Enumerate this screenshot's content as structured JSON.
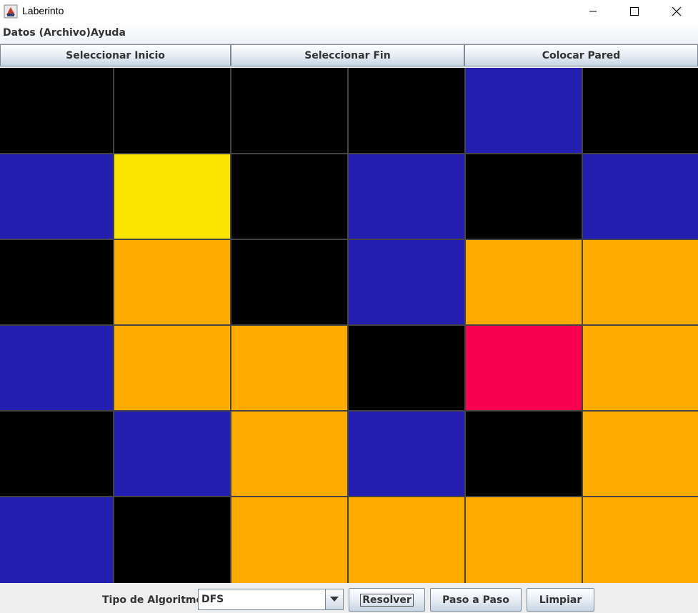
{
  "window": {
    "title": "Laberinto",
    "icon": "java-cup-icon",
    "controls": [
      "minimize-icon",
      "maximize-icon",
      "close-icon"
    ]
  },
  "menu": [
    {
      "label": "Datos (Archivo)"
    },
    {
      "label": "Ayuda"
    }
  ],
  "toolbar": {
    "select_start": "Seleccionar Inicio",
    "select_end": "Seleccionar Fin",
    "place_wall": "Colocar Pared"
  },
  "maze": {
    "rows": 6,
    "cols": 6,
    "colors": {
      "wall": "#000000",
      "open": "#241fb0",
      "start": "#f9e400",
      "visited": "#ffab00",
      "end": "#f6004f",
      "gridline": "#444444"
    },
    "cells": [
      [
        "wall",
        "wall",
        "wall",
        "wall",
        "open",
        "wall"
      ],
      [
        "open",
        "start",
        "wall",
        "open",
        "wall",
        "open"
      ],
      [
        "wall",
        "visited",
        "wall",
        "open",
        "visited",
        "visited"
      ],
      [
        "open",
        "visited",
        "visited",
        "wall",
        "end",
        "visited"
      ],
      [
        "wall",
        "open",
        "visited",
        "open",
        "wall",
        "visited"
      ],
      [
        "open",
        "wall",
        "visited",
        "visited",
        "visited",
        "visited"
      ]
    ]
  },
  "bottom": {
    "algorithm_label": "Tipo de Algoritmo:",
    "algorithm_selected": "DFS",
    "solve": "Resolver",
    "step": "Paso a Paso",
    "clear": "Limpiar"
  }
}
